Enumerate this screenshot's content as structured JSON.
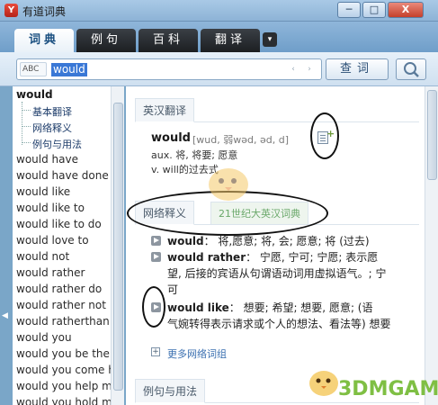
{
  "window": {
    "title": "有道词典",
    "buttons": {
      "minimize": "─",
      "maximize": "□",
      "close": "X"
    }
  },
  "tabs": [
    {
      "label": "词典",
      "active": true
    },
    {
      "label": "例句",
      "active": false
    },
    {
      "label": "百科",
      "active": false
    },
    {
      "label": "翻译",
      "active": false
    }
  ],
  "tabs_more_icon": "▾",
  "search": {
    "lang_label": "ABC",
    "value": "would",
    "prev_icon": "‹",
    "next_icon": "›",
    "lookup_label": "查词"
  },
  "word_list": {
    "head": "would",
    "tree": [
      "基本翻译",
      "网络释义",
      "例句与用法"
    ],
    "items": [
      "would have",
      "would have done",
      "would like",
      "would like to",
      "would like to do",
      "would love to",
      "would not",
      "would rather",
      "would rather do",
      "would rather not",
      "would ratherthan",
      "would you",
      "would you be the s",
      "would you come h",
      "would you help me",
      "would you hold my"
    ]
  },
  "entry": {
    "section1": "英汉翻译",
    "headword": "would",
    "phonetic": "[wud, 弱wəd, əd, d]",
    "defs": [
      "aux. 将, 将要; 愿意",
      "v. will的过去式"
    ],
    "section2": "网络释义",
    "section2_tab": "21世纪大英汉词典",
    "net_entries": [
      {
        "term": "would",
        "text": "： 将,愿意; 将, 会; 愿意; 将 (过去)"
      },
      {
        "term": "would rather",
        "text": "： 宁愿, 宁可; 宁愿; 表示愿"
      },
      {
        "term": "would like",
        "text": "： 想要; 希望; 想要, 愿意; (语"
      }
    ],
    "cont_lines": [
      "望, 后接的宾语从句谓语动词用虚拟语气。; 宁",
      "可",
      "气婉转得表示请求或个人的想法、看法等) 想要"
    ],
    "more_label": "更多网络词组",
    "section3": "例句与用法"
  },
  "watermark": "3DMGAME",
  "colors": {
    "accent": "#3a78d6",
    "tab_dark": "#1c1f22",
    "link": "#3a6fb0",
    "watermark": "#7fbf44"
  }
}
